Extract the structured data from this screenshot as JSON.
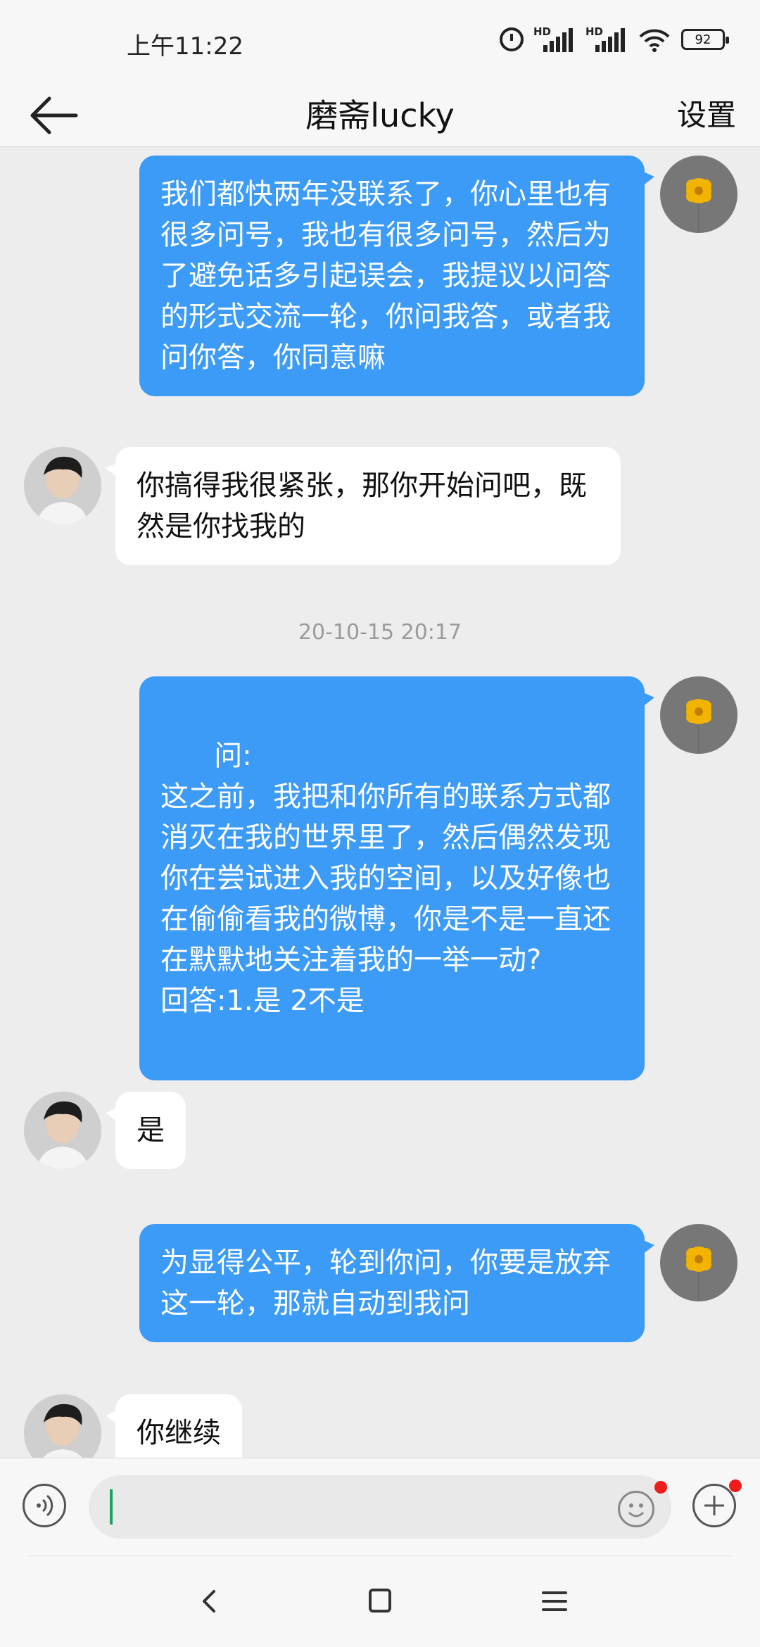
{
  "status_bar": {
    "time": "上午11:22",
    "battery": "92",
    "hd1": "HD",
    "hd2": "HD"
  },
  "header": {
    "back_icon": "arrow-left-icon",
    "title": "磨斋lucky",
    "settings_label": "设置"
  },
  "messages": [
    {
      "direction": "out",
      "text": "我们都快两年没联系了，你心里也有很多问号，我也有很多问号，然后为了避免话多引起误会，我提议以问答的形式交流一轮，你问我答，或者我问你答，你同意嘛"
    },
    {
      "direction": "in",
      "text": "你搞得我很紧张，那你开始问吧，既然是你找我的"
    },
    {
      "type": "timestamp",
      "text": "20-10-15 20:17"
    },
    {
      "direction": "out",
      "text": "问:\n这之前，我把和你所有的联系方式都消灭在我的世界里了，然后偶然发现你在尝试进入我的空间，以及好像也在偷偷看我的微博，你是不是一直还在默默地关注着我的一举一动?\n回答:1.是 2不是"
    },
    {
      "direction": "in",
      "text": "是"
    },
    {
      "direction": "out",
      "text": "为显得公平，轮到你问，你要是放弃这一轮，那就自动到我问"
    },
    {
      "direction": "in",
      "text": "你继续"
    }
  ],
  "input_bar": {
    "voice_icon": "voice-icon",
    "emoji_icon": "emoji-icon",
    "plus_icon": "plus-icon",
    "placeholder": ""
  },
  "colors": {
    "outgoing_bubble": "#3c9bf6",
    "incoming_bubble": "#ffffff",
    "background": "#ededed",
    "cursor": "#1aa260",
    "badge": "#f01b1b"
  }
}
